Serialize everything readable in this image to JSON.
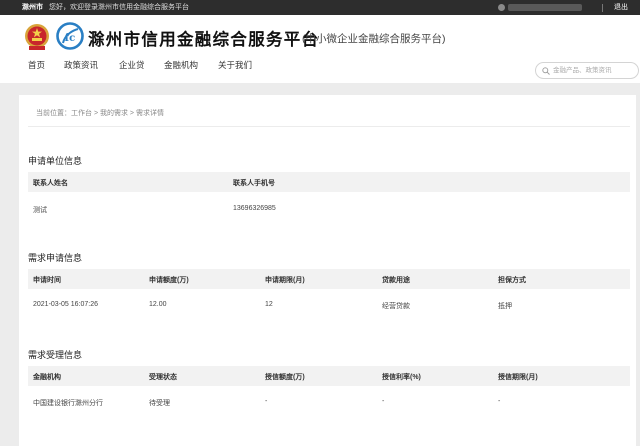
{
  "topbar": {
    "city": "滁州市",
    "welcome": "您好，欢迎登录滁州市信用金融综合服务平台",
    "logout": "退出"
  },
  "header": {
    "title": "滁州市信用金融综合服务平台",
    "subtitle": "(中小微企业金融综合服务平台)",
    "nav": [
      "首页",
      "政策资讯",
      "企业贷",
      "金融机构",
      "关于我们"
    ],
    "search_placeholder": "金融产品、政策资讯"
  },
  "breadcrumb": "当前位置：工作台 > 我的需求 > 需求详情",
  "sections": {
    "applicant": {
      "title": "申请单位信息",
      "headers": [
        "联系人姓名",
        "联系人手机号"
      ],
      "row": [
        "测试",
        "13696326985"
      ]
    },
    "demand": {
      "title": "需求申请信息",
      "headers": [
        "申请时间",
        "申请额度(万)",
        "申请期限(月)",
        "贷款用途",
        "担保方式"
      ],
      "row": [
        "2021-03-05 16:07:26",
        "12.00",
        "12",
        "经营贷款",
        "抵押"
      ]
    },
    "acceptance": {
      "title": "需求受理信息",
      "headers": [
        "金融机构",
        "受理状态",
        "授信额度(万)",
        "授信利率(%)",
        "授信期限(月)"
      ],
      "row": [
        "中国建设银行滁州分行",
        "待受理",
        "-",
        "-",
        "-"
      ]
    }
  }
}
